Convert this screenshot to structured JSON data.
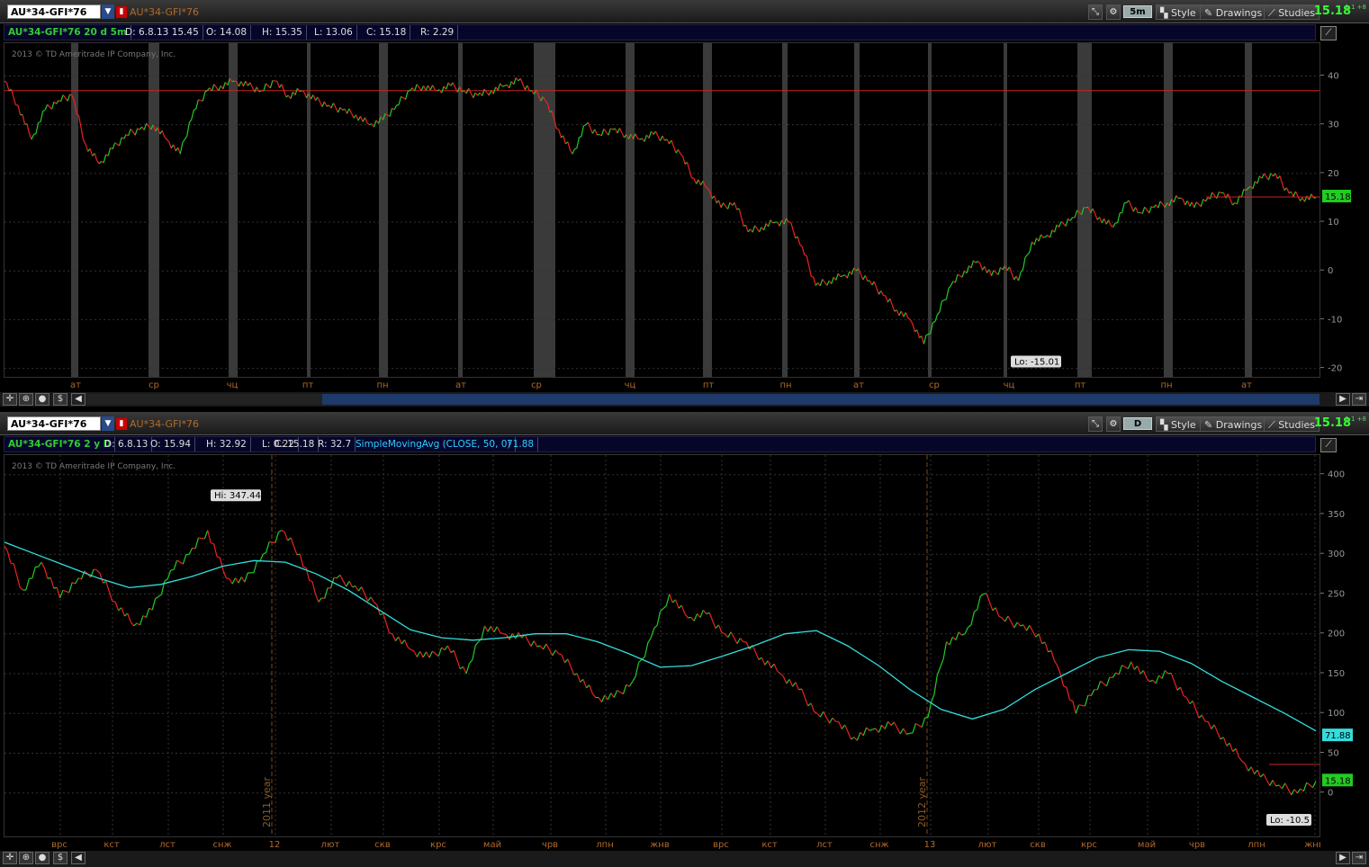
{
  "top": {
    "symbol": "AU*34-GFI*76",
    "title": "AU*34-GFI*76",
    "agg": "5m",
    "style_label": "Style",
    "drawings_label": "Drawings",
    "studies_label": "Studies",
    "last_price": "15.18",
    "tiny": "1.1 +8",
    "info": [
      "AU*34-GFI*76 20 d 5m",
      "D: 6.8.13 15.45",
      "O: 14.08",
      "H: 15.35",
      "L: 13.06",
      "C: 15.18",
      "R: 2.29"
    ],
    "copyright": "2013 © TD Ameritrade IP Company, Inc.",
    "lo_label": "Lo: -15.01",
    "price_badge": "15.18",
    "icons": {
      "crosshair": "crosshair-icon",
      "zoom": "zoom-icon",
      "pan": "pan-icon",
      "dollar": "dollar-icon"
    }
  },
  "bottom": {
    "symbol": "AU*34-GFI*76",
    "title": "AU*34-GFI*76",
    "agg": "D",
    "style_label": "Style",
    "drawings_label": "Drawings",
    "studies_label": "Studies",
    "last_price": "15.18",
    "tiny": "1.1 +8",
    "info": [
      "AU*34-GFI*76 2 y D",
      "D: 6.8.13",
      "O: 15.94",
      "H: 32.92",
      "L: 0.22",
      "C: 15.18",
      "R: 32.7",
      "SimpleMovingAvg (CLOSE, 50, 0)",
      "71.88"
    ],
    "copyright": "2013 © TD Ameritrade IP Company, Inc.",
    "hi_label": "Hi: 347.44",
    "lo_label": "Lo: -10.5",
    "sma_badge": "71.88",
    "price_badge": "15.18",
    "year_labels": [
      "2011 year",
      "2012 year"
    ]
  },
  "chart_data": [
    {
      "type": "line",
      "title": "AU*34-GFI*76 20 d 5m",
      "x_tick_labels": [
        "ат",
        "ср",
        "чц",
        "пт",
        "пн",
        "ат",
        "ср",
        "чц",
        "пт",
        "пн",
        "ат",
        "ср",
        "чц",
        "пт",
        "пн",
        "ат"
      ],
      "y_ticks": [
        40,
        30,
        20,
        10,
        0,
        -10,
        -20
      ],
      "ylim": [
        -21,
        46
      ],
      "hline": 37,
      "series": [
        {
          "values": [
            39,
            34,
            27,
            33,
            35,
            36,
            26,
            22,
            25,
            28,
            29,
            30,
            27,
            24,
            33,
            37,
            38,
            39,
            38,
            37,
            39,
            36,
            37,
            35,
            34,
            33,
            32,
            30,
            31,
            34,
            37,
            38,
            37,
            38,
            37,
            36,
            37,
            38,
            39,
            37,
            35,
            29,
            24,
            30,
            28,
            29,
            28,
            27,
            28,
            27,
            24,
            19,
            17,
            13,
            14,
            8,
            9,
            10,
            10,
            5,
            -3,
            -2,
            -1,
            0,
            -2,
            -5,
            -8,
            -10,
            -15,
            -9,
            -3,
            0,
            2,
            -1,
            1,
            -2,
            6,
            7,
            9,
            11,
            13,
            11,
            9,
            14,
            12,
            13,
            14,
            15,
            13,
            15,
            16,
            14,
            17,
            19,
            20,
            16,
            15,
            15
          ]
        }
      ]
    },
    {
      "type": "line",
      "title": "AU*34-GFI*76 2 y D",
      "x_tick_labels": [
        "врс",
        "кст",
        "лст",
        "снж",
        "12",
        "лют",
        "скв",
        "крс",
        "май",
        "чрв",
        "лпн",
        "жнв",
        "врс",
        "кст",
        "лст",
        "снж",
        "13",
        "лют",
        "скв",
        "крс",
        "май",
        "чрв",
        "лпн",
        "жнв"
      ],
      "y_ticks": [
        400,
        350,
        300,
        250,
        200,
        150,
        100,
        50,
        0
      ],
      "ylim": [
        -50,
        420
      ],
      "series": [
        {
          "name": "Close",
          "values": [
            310,
            255,
            290,
            245,
            270,
            280,
            240,
            210,
            230,
            280,
            300,
            330,
            270,
            265,
            300,
            330,
            300,
            240,
            270,
            260,
            240,
            200,
            180,
            170,
            185,
            150,
            210,
            200,
            195,
            185,
            175,
            150,
            120,
            120,
            140,
            195,
            250,
            220,
            225,
            200,
            190,
            170,
            150,
            130,
            100,
            90,
            70,
            80,
            85,
            75,
            95,
            190,
            200,
            250,
            220,
            210,
            200,
            160,
            100,
            130,
            145,
            165,
            140,
            150,
            120,
            90,
            70,
            40,
            20,
            10,
            0,
            15
          ]
        },
        {
          "name": "SimpleMovingAvg (CLOSE, 50, 0)",
          "values": [
            315,
            300,
            285,
            270,
            258,
            262,
            272,
            285,
            292,
            290,
            275,
            255,
            230,
            205,
            195,
            192,
            195,
            200,
            200,
            190,
            175,
            158,
            160,
            172,
            185,
            200,
            204,
            185,
            160,
            130,
            105,
            93,
            105,
            130,
            150,
            170,
            180,
            178,
            163,
            140,
            120,
            100,
            78
          ]
        }
      ]
    }
  ]
}
